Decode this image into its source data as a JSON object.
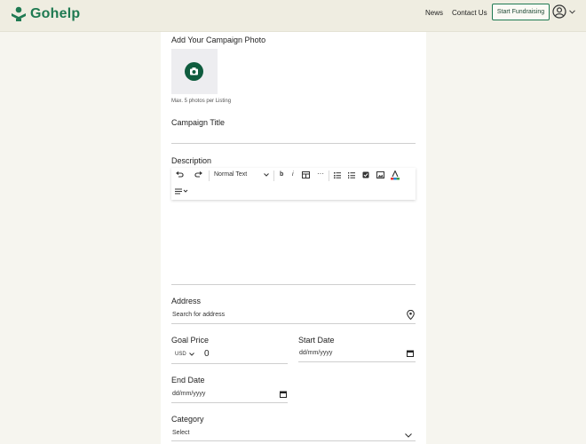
{
  "brand": {
    "name": "Gohelp"
  },
  "nav": {
    "news": "News",
    "contact": "Contact Us",
    "start": "Start Fundraising"
  },
  "form": {
    "photo_label": "Add Your Campaign Photo",
    "photo_hint": "Max. 5 photos per Listing",
    "title_label": "Campaign Title",
    "description_label": "Description",
    "editor_style": "Normal Text",
    "address_label": "Address",
    "address_placeholder": "Search for address",
    "goal_label": "Goal Price",
    "currency": "USD",
    "goal_value": "0",
    "start_label": "Start Date",
    "start_placeholder": "dd/mm/yyyy",
    "end_label": "End Date",
    "end_placeholder": "dd/mm/yyyy",
    "category_label": "Category",
    "category_value": "Select"
  },
  "colors": {
    "brand": "#1f7a52",
    "accent_dark": "#0f5c3e",
    "header_bg": "#efede1",
    "page_bg": "#f6f5ef"
  },
  "icons": [
    "logo-icon",
    "user-icon",
    "chevron-down-icon",
    "camera-icon",
    "undo-icon",
    "redo-icon",
    "bold-icon",
    "italic-icon",
    "table-icon",
    "more-icon",
    "bullet-list-icon",
    "numbered-list-icon",
    "checkbox-icon",
    "image-icon",
    "text-color-icon",
    "align-icon",
    "location-pin-icon",
    "calendar-icon"
  ]
}
